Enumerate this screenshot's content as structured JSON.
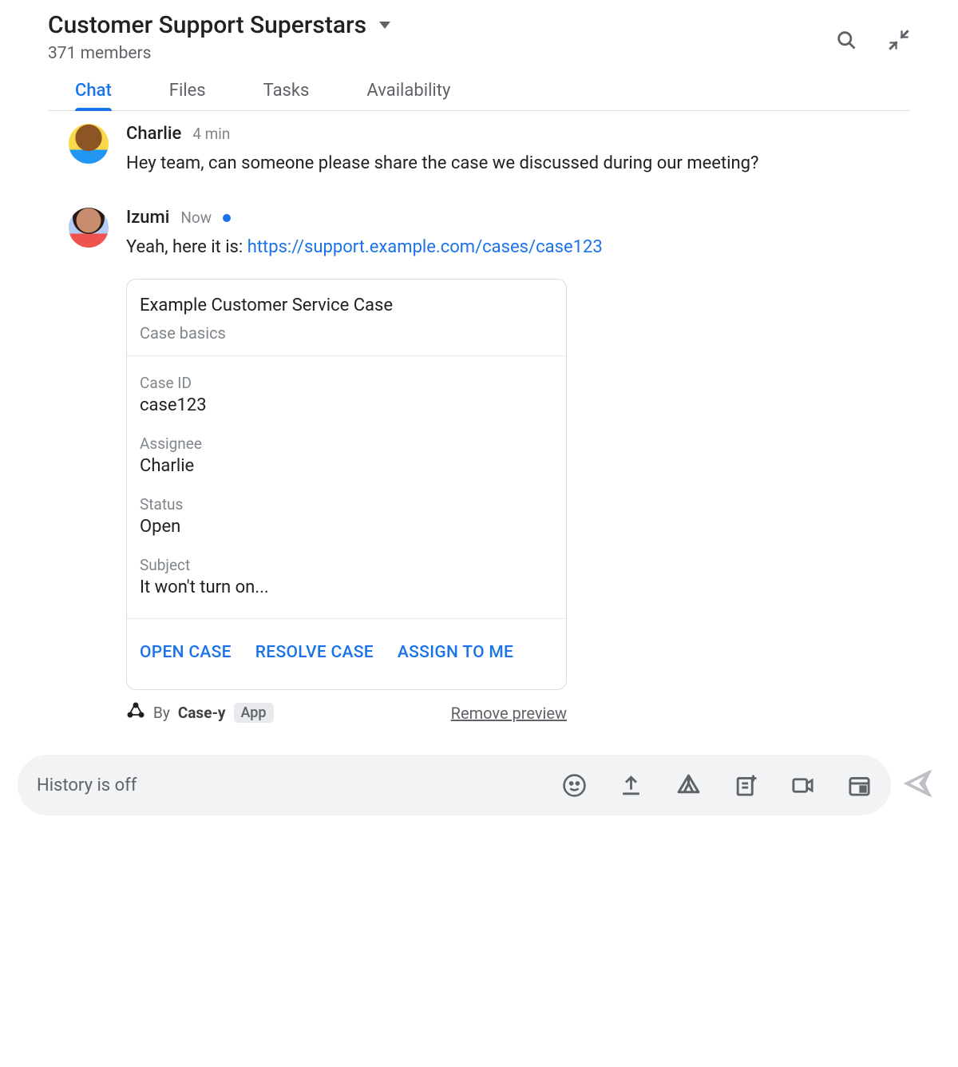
{
  "header": {
    "title": "Customer Support Superstars",
    "members": "371 members"
  },
  "tabs": [
    {
      "label": "Chat",
      "active": true
    },
    {
      "label": "Files",
      "active": false
    },
    {
      "label": "Tasks",
      "active": false
    },
    {
      "label": "Availability",
      "active": false
    }
  ],
  "messages": [
    {
      "author": "Charlie",
      "time": "4 min",
      "new": false,
      "text": "Hey team, can someone please share the case we discussed during our meeting?"
    },
    {
      "author": "Izumi",
      "time": "Now",
      "new": true,
      "text_prefix": "Yeah, here it is: ",
      "link": "https://support.example.com/cases/case123"
    }
  ],
  "card": {
    "title": "Example Customer Service Case",
    "subtitle": "Case basics",
    "fields": [
      {
        "label": "Case ID",
        "value": "case123"
      },
      {
        "label": "Assignee",
        "value": "Charlie"
      },
      {
        "label": "Status",
        "value": "Open"
      },
      {
        "label": "Subject",
        "value": "It won't turn on..."
      }
    ],
    "actions": [
      {
        "label": "OPEN CASE"
      },
      {
        "label": "RESOLVE CASE"
      },
      {
        "label": "ASSIGN TO ME"
      }
    ],
    "footer": {
      "by": "By",
      "app_name": "Case-y",
      "app_badge": "App",
      "remove": "Remove preview"
    }
  },
  "composer": {
    "placeholder": "History is off"
  }
}
